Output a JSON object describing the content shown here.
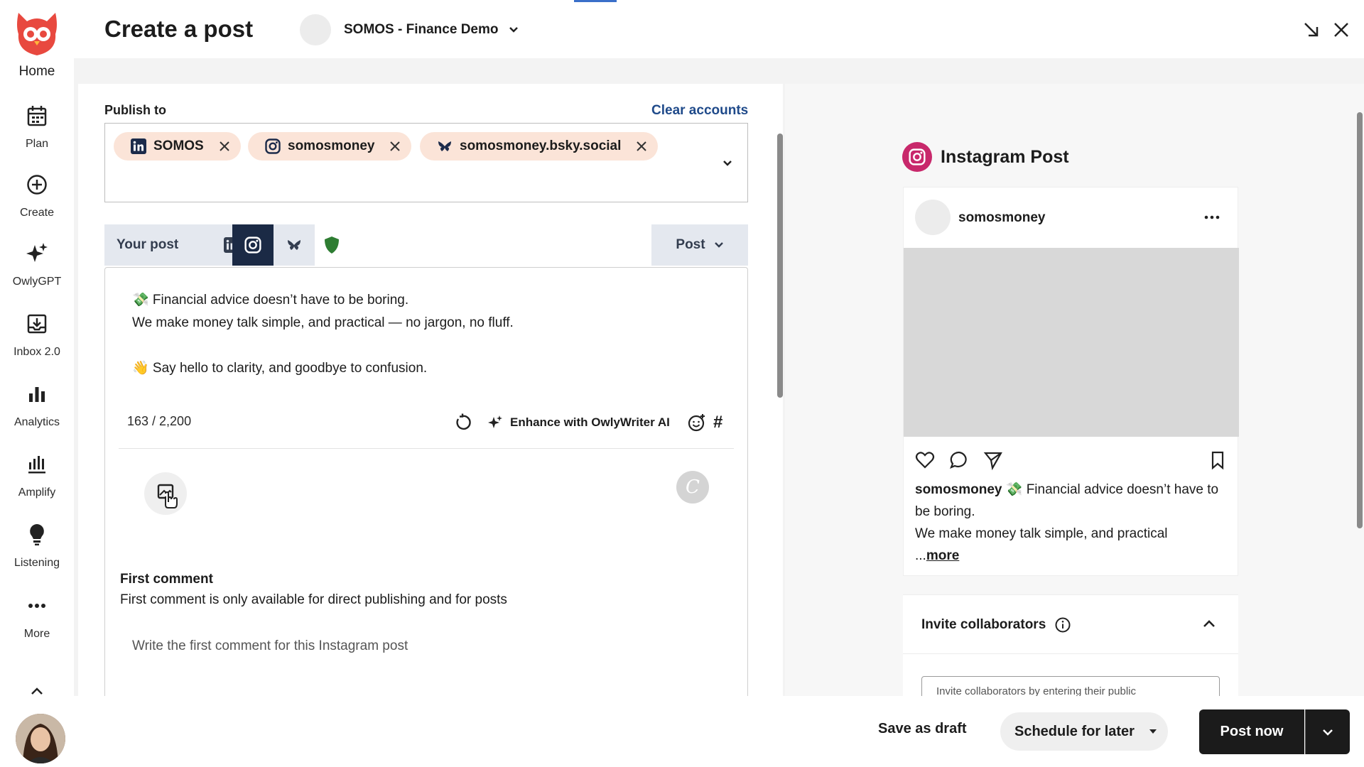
{
  "sidebar": {
    "home_label": "Home",
    "items": [
      {
        "label": "Plan",
        "icon": "calendar-icon"
      },
      {
        "label": "Create",
        "icon": "plus-circle-icon"
      },
      {
        "label": "OwlyGPT",
        "icon": "sparkle-icon"
      },
      {
        "label": "Inbox 2.0",
        "icon": "inbox-icon"
      },
      {
        "label": "Analytics",
        "icon": "bar-chart-icon"
      },
      {
        "label": "Amplify",
        "icon": "amplify-icon"
      },
      {
        "label": "Listening",
        "icon": "lightbulb-icon"
      },
      {
        "label": "More",
        "icon": "more-icon"
      }
    ]
  },
  "header": {
    "title": "Create a post",
    "org_name": "SOMOS - Finance Demo"
  },
  "publish": {
    "label": "Publish to",
    "clear_label": "Clear accounts",
    "accounts": [
      {
        "name": "SOMOS",
        "network": "linkedin"
      },
      {
        "name": "somosmoney",
        "network": "instagram"
      },
      {
        "name": "somosmoney.bsky.social",
        "network": "bluesky"
      }
    ]
  },
  "tabs": {
    "your_post_label": "Your post",
    "networks": [
      "linkedin",
      "instagram",
      "bluesky"
    ],
    "active": "instagram",
    "post_type_label": "Post"
  },
  "composer": {
    "lines": [
      "💸 Financial advice doesn’t have to be boring.",
      "We make money talk simple, and practical — no jargon, no fluff.",
      "",
      "👋 Say hello to clarity, and goodbye to confusion."
    ],
    "char_count": "163 / 2,200",
    "enhance_label": "Enhance with OwlyWriter AI",
    "hashtag_label": "#",
    "canva_label": "C",
    "first_comment_title": "First comment",
    "first_comment_note": "First comment is only available for direct publishing and for posts",
    "first_comment_placeholder": "Write the first comment for this Instagram post"
  },
  "preview": {
    "title": "Instagram Post",
    "username": "somosmoney",
    "caption_user": "somosmoney",
    "caption_line1": " 💸 Financial advice doesn’t have to be boring.",
    "caption_line2": "We make money talk simple, and practical",
    "more_prefix": "...",
    "more_label": "more"
  },
  "collaborators": {
    "title": "Invite collaborators",
    "input_placeholder": "Invite collaborators by entering their public"
  },
  "footer": {
    "save_draft_label": "Save as draft",
    "schedule_label": "Schedule for later",
    "post_now_label": "Post now"
  },
  "colors": {
    "brand_accent": "#e8493f",
    "chip_bg": "#fbe4d8",
    "active_tab": "#1b2a45",
    "link": "#1f4a8a",
    "instagram": "#c8286b",
    "primary_button": "#1b1b1b"
  }
}
